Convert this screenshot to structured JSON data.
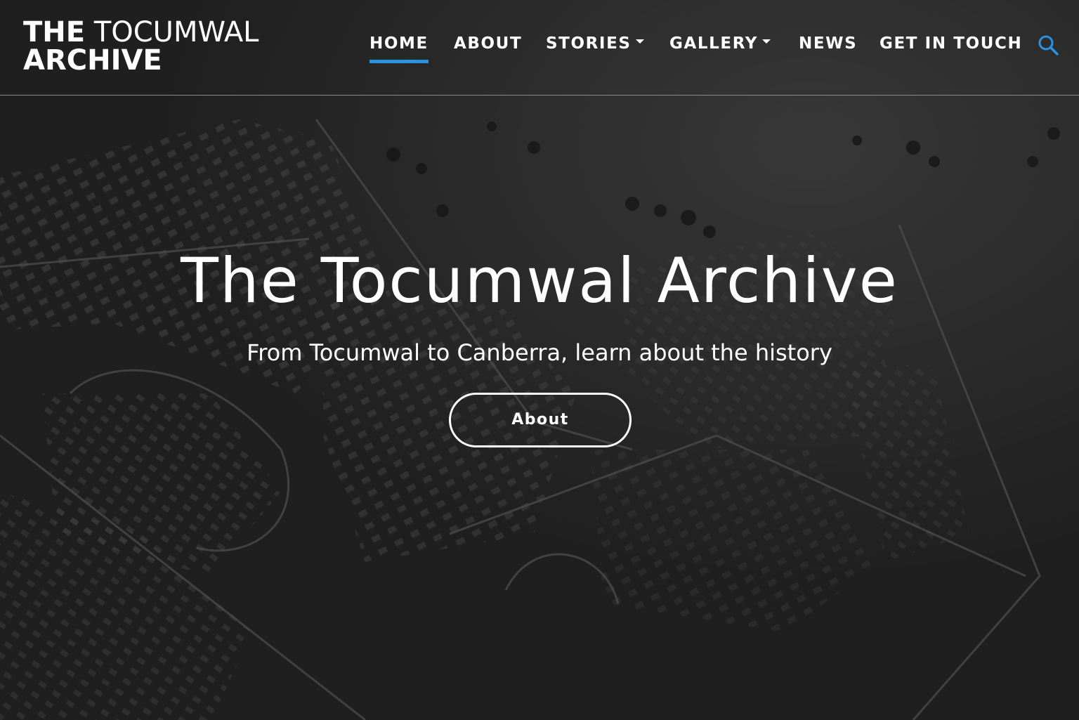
{
  "site": {
    "logo_line1_bold": "THE",
    "logo_line1_light": "TOCUMWAL",
    "logo_line2": "ARCHIVE"
  },
  "nav": {
    "items": [
      {
        "label": "HOME",
        "active": true,
        "dropdown": false
      },
      {
        "label": "ABOUT",
        "active": false,
        "dropdown": false
      },
      {
        "label": "STORIES",
        "active": false,
        "dropdown": true
      },
      {
        "label": "GALLERY",
        "active": false,
        "dropdown": true
      },
      {
        "label": "NEWS",
        "active": false,
        "dropdown": false
      },
      {
        "label": "GET IN TOUCH",
        "active": false,
        "dropdown": false
      }
    ],
    "search_icon": "search-icon",
    "accent_color": "#2a92e0"
  },
  "hero": {
    "title": "The Tocumwal Archive",
    "subtitle": "From Tocumwal to Canberra, learn about the history",
    "button_label": "About"
  }
}
